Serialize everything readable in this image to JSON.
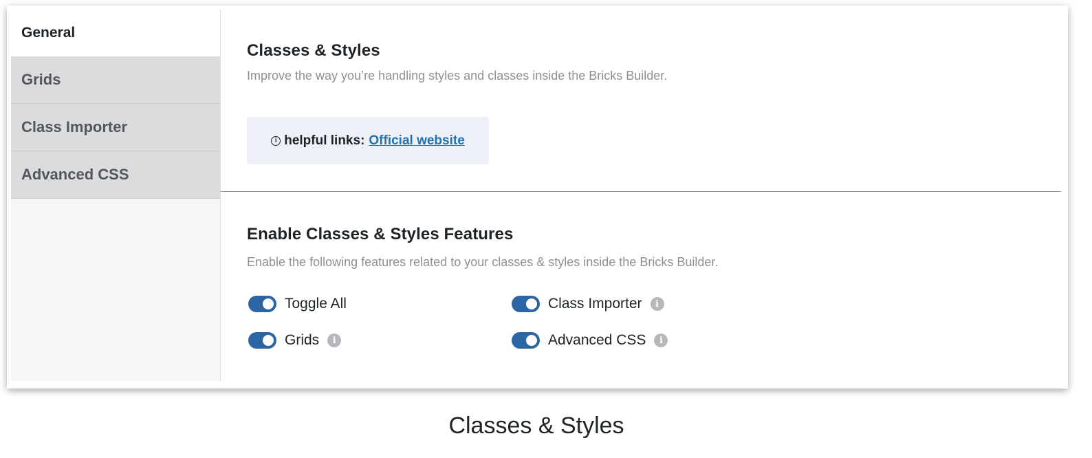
{
  "sidebar": {
    "tabs": [
      {
        "label": "General"
      },
      {
        "label": "Grids"
      },
      {
        "label": "Class Importer"
      },
      {
        "label": "Advanced CSS"
      }
    ]
  },
  "header": {
    "title": "Classes & Styles",
    "description": "Improve the way you’re handling styles and classes inside the Bricks Builder."
  },
  "notice": {
    "icon": "info-circle-icon",
    "prefix": "helpful links:",
    "link_label": "Official website"
  },
  "features": {
    "title": "Enable Classes & Styles Features",
    "description": "Enable the following features related to your classes & styles inside the Bricks Builder.",
    "toggles": [
      {
        "label": "Toggle All",
        "enabled": true
      },
      {
        "label": "Class Importer",
        "enabled": true
      },
      {
        "label": "Grids",
        "enabled": true
      },
      {
        "label": "Advanced CSS",
        "enabled": true
      }
    ]
  },
  "caption": "Classes & Styles",
  "colors": {
    "accent": "#2c65a4",
    "link": "#2271b1",
    "notice_bg": "#edf1f7",
    "tab_inactive_bg": "#dcdcde"
  }
}
